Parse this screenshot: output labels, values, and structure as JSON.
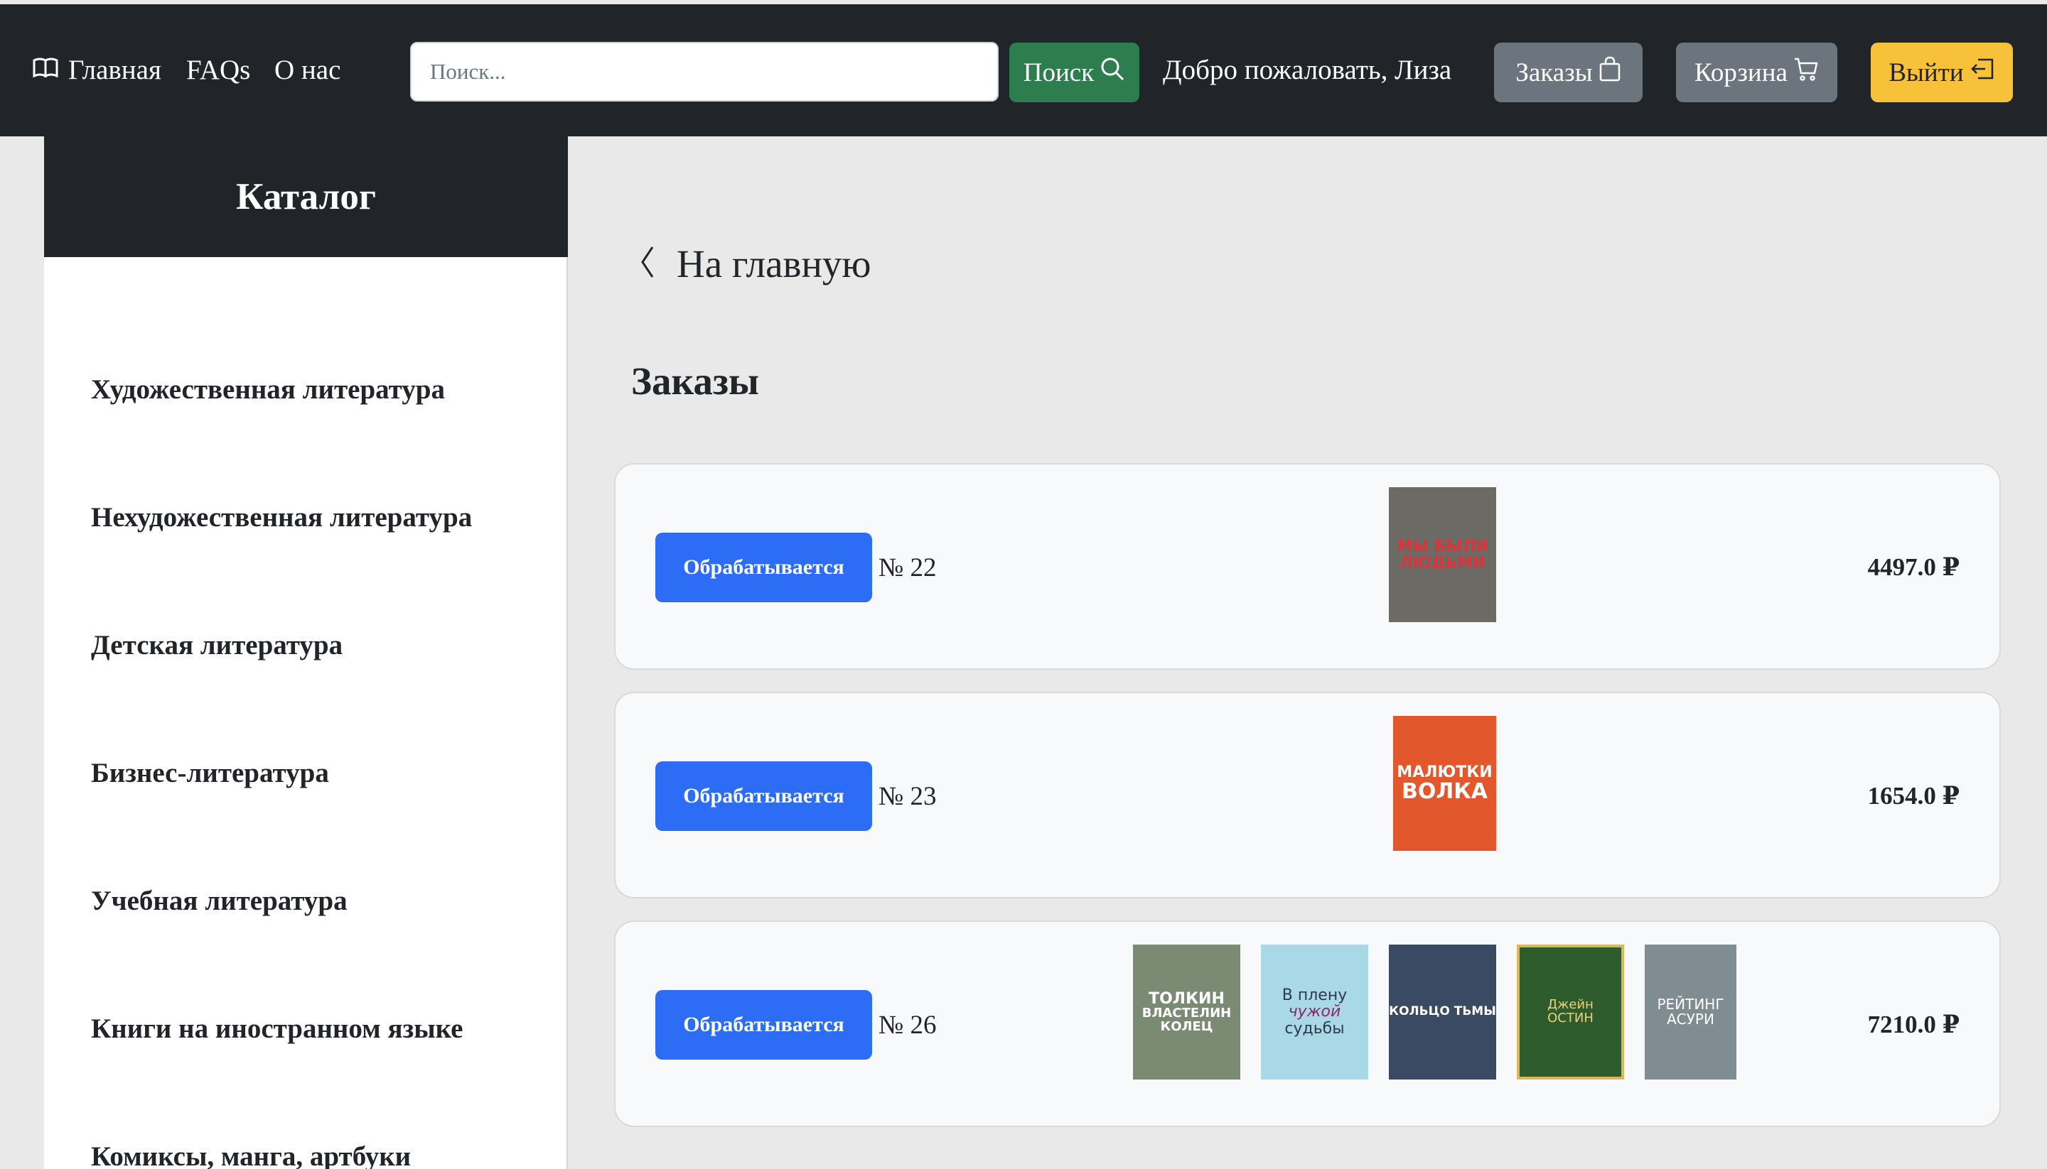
{
  "nav": {
    "home_label": "Главная",
    "faq_label": "FAQs",
    "about_label": "О нас",
    "search_placeholder": "Поиск...",
    "search_button": "Поиск",
    "welcome_text": "Добро пожаловать, Лиза",
    "orders_button": "Заказы",
    "cart_button": "Корзина",
    "logout_button": "Выйти",
    "colors": {
      "bg": "#212529",
      "search_btn": "#2e7d4f",
      "secondary_btn": "#6c757d",
      "logout_btn": "#f7c23a"
    }
  },
  "sidebar": {
    "title": "Каталог",
    "categories": [
      "Художественная литература",
      "Нехудожественная литература",
      "Детская литература",
      "Бизнес-литература",
      "Учебная литература",
      "Книги на иностранном языке",
      "Комиксы, манга, артбуки"
    ]
  },
  "main": {
    "back_label": "На главную",
    "page_title": "Заказы",
    "status_color": "#2d6df6",
    "orders": [
      {
        "status": "Обрабатывается",
        "number": "№ 22",
        "total": "4497.0 ₽",
        "books": [
          {
            "lines": [
              "МЫ БЫЛИ",
              "ЛЮДЬМИ"
            ],
            "bg": "#6b6a64",
            "fg": "#d9353a"
          }
        ]
      },
      {
        "status": "Обрабатывается",
        "number": "№ 23",
        "total": "1654.0 ₽",
        "books": [
          {
            "lines": [
              "МАЛЮТКИ",
              "ВОЛКА"
            ],
            "bg": "#e2572b",
            "fg": "#ffffff"
          }
        ]
      },
      {
        "status": "Обрабатывается",
        "number": "№ 26",
        "total": "7210.0 ₽",
        "books": [
          {
            "lines": [
              "ТОЛКИН",
              "ВЛАСТЕЛИН",
              "КОЛЕЦ"
            ],
            "bg": "#7a8a73",
            "fg": "#ffffff"
          },
          {
            "lines": [
              "В плену",
              "чужой",
              "судьбы"
            ],
            "bg": "#a9d8e6",
            "fg": "#2b3b4a"
          },
          {
            "lines": [
              "КОЛЬЦО ТЬМЫ"
            ],
            "bg": "#3b4a63",
            "fg": "#ffffff"
          },
          {
            "lines": [
              "Джейн",
              "ОСТИН"
            ],
            "bg": "#2f5c2c",
            "fg": "#e9d27a"
          },
          {
            "lines": [
              "РЕЙТИНГ",
              "АСУРИ"
            ],
            "bg": "#7f8c92",
            "fg": "#ffffff"
          }
        ]
      }
    ]
  }
}
